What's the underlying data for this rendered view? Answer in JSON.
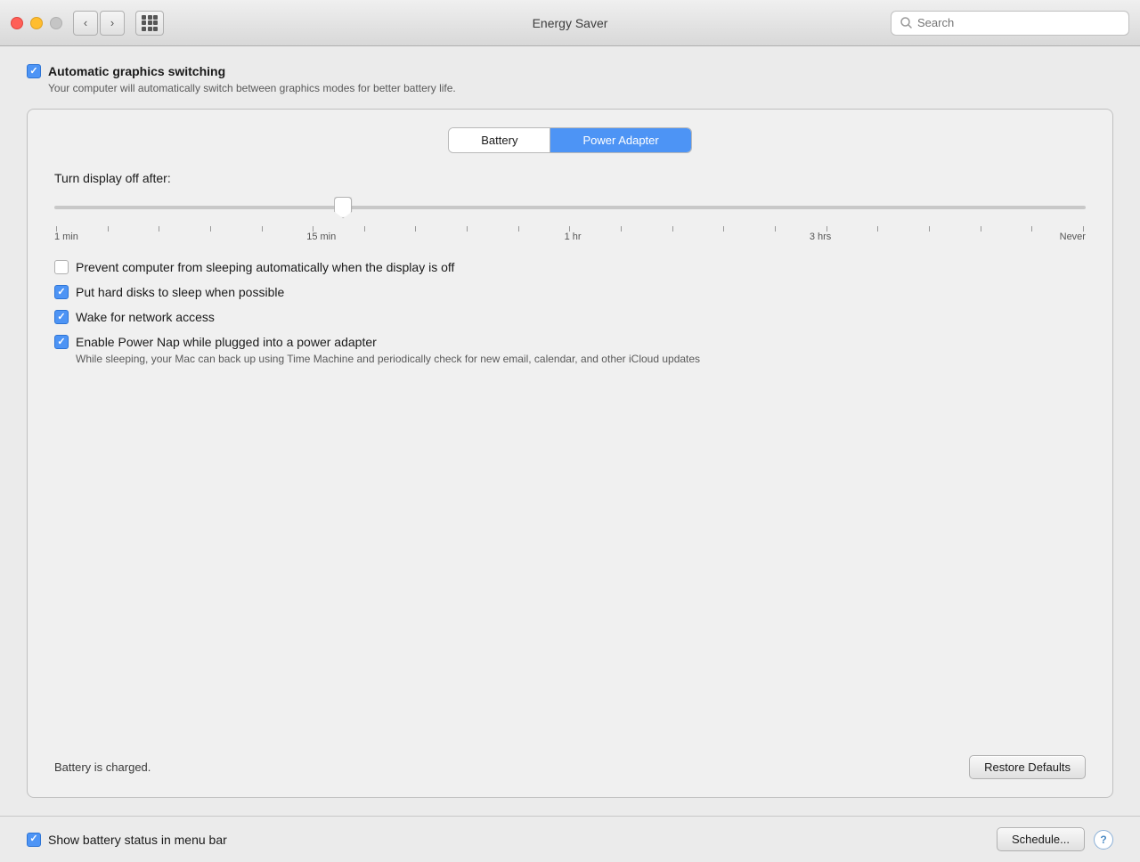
{
  "titlebar": {
    "title": "Energy Saver",
    "search_placeholder": "Search",
    "nav_back": "‹",
    "nav_forward": "›"
  },
  "auto_graphics": {
    "label": "Automatic graphics switching",
    "checked": true,
    "description": "Your computer will automatically switch between graphics modes for better battery life."
  },
  "tabs": {
    "battery_label": "Battery",
    "power_adapter_label": "Power Adapter",
    "active": "power_adapter"
  },
  "slider": {
    "label": "Turn display off after:",
    "ticks": [
      "",
      "",
      "",
      "",
      "",
      "",
      "",
      "",
      "",
      "",
      "",
      "",
      "",
      "",
      "",
      "",
      "",
      "",
      "",
      "",
      ""
    ],
    "labels": [
      "1 min",
      "15 min",
      "1 hr",
      "3 hrs",
      "Never"
    ],
    "value_position": 28
  },
  "checkboxes": [
    {
      "id": "prevent-sleep",
      "label": "Prevent computer from sleeping automatically when the display is off",
      "checked": false
    },
    {
      "id": "hard-disks",
      "label": "Put hard disks to sleep when possible",
      "checked": true
    },
    {
      "id": "wake-network",
      "label": "Wake for network access",
      "checked": true
    },
    {
      "id": "power-nap",
      "label": "Enable Power Nap while plugged into a power adapter",
      "checked": true,
      "description": "While sleeping, your Mac can back up using Time Machine and periodically check for new email, calendar, and other iCloud updates"
    }
  ],
  "panel_footer": {
    "status": "Battery is charged.",
    "restore_btn": "Restore Defaults"
  },
  "bottom_bar": {
    "show_battery_label": "Show battery status in menu bar",
    "show_battery_checked": true,
    "schedule_btn": "Schedule...",
    "help_btn": "?"
  }
}
